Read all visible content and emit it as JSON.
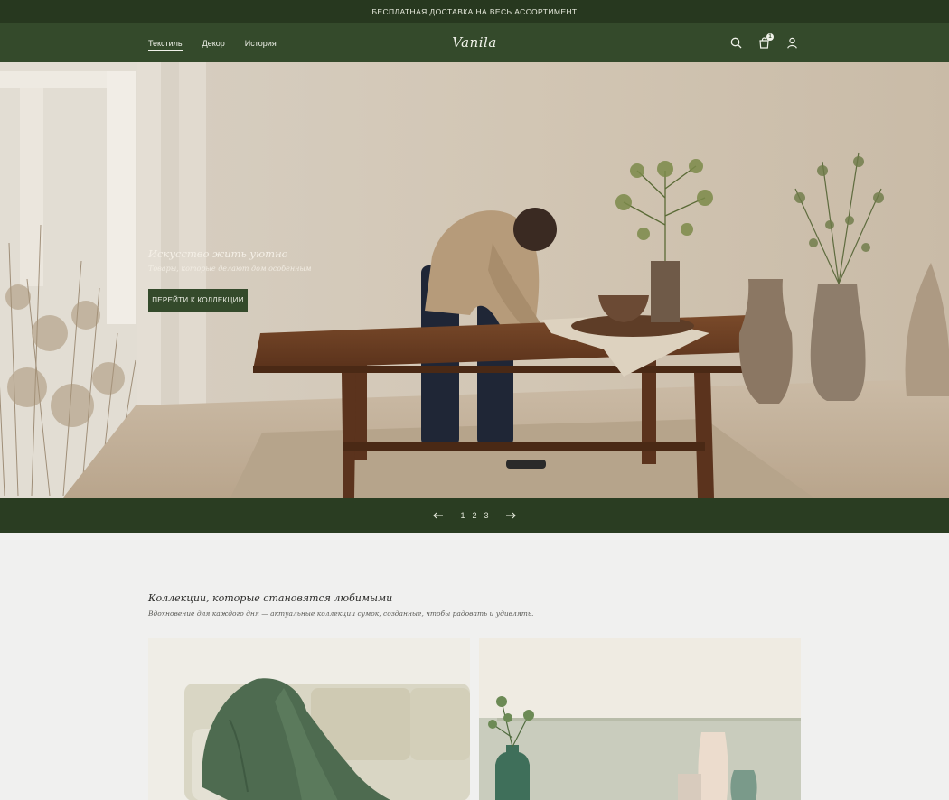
{
  "topbar": {
    "text": "БЕСПЛАТНАЯ ДОСТАВКА НА ВЕСЬ АССОРТИМЕНТ"
  },
  "nav": {
    "links": [
      "Текстиль",
      "Декор",
      "История"
    ],
    "logo": "Vanila",
    "icons": [
      "search-icon",
      "cart-icon",
      "user-icon"
    ],
    "cart_count": "1"
  },
  "hero": {
    "title": "Искусство жить уютно",
    "subtitle": "Товары, которые делают дом особенным",
    "button": "ПЕРЕЙТИ К КОЛЛЕКЦИИ"
  },
  "slider": {
    "pages": [
      "1",
      "2",
      "3"
    ],
    "prev_icon": "arrow-left-icon",
    "next_icon": "arrow-right-icon"
  },
  "collections": {
    "title": "Коллекции, которые становятся любимыми",
    "subtitle": "Вдохновение для каждого дня — актуальные коллекции сумок, созданные, чтобы радовать и удивлять."
  },
  "colors": {
    "topbar": "#27381f",
    "nav": "#344a2b",
    "slider": "#2a3d22",
    "background": "#f0f0ef"
  }
}
